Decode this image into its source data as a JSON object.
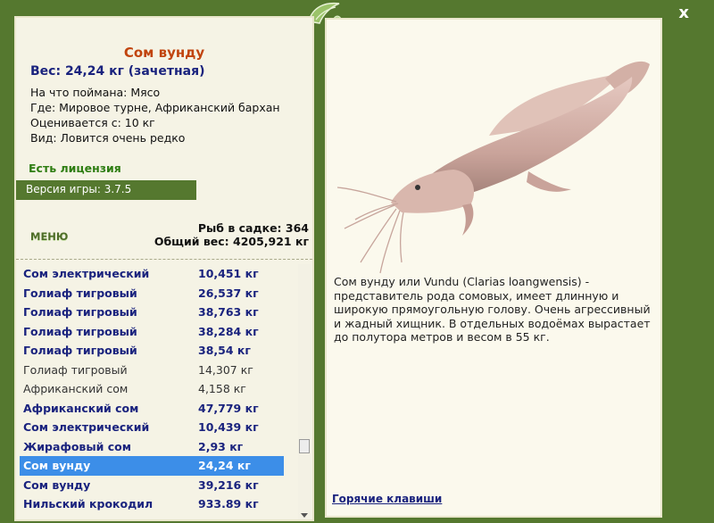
{
  "window": {
    "close_label": "x"
  },
  "fish": {
    "title": "Сом вунду",
    "weight_line": "Вес: 24,24 кг (зачетная)",
    "info": [
      "На что поймана: Мясо",
      "Где: Мировое турне, Африканский бархан",
      "Оценивается с: 10 кг",
      "Вид: Ловится очень редко"
    ],
    "description": "Сом вунду или Vundu (Clarias loangwensis) - представитель рода сомовых, имеет длинную и широкую прямоугольную голову. Очень агрессивный и жадный хищник. В отдельных водоёмах вырастает до полутора метров и весом в 55 кг."
  },
  "license": "Есть лицензия",
  "version": "Версия игры: 3.7.5",
  "menu_label": "МЕНЮ",
  "stats": {
    "cage_count": "Рыб в садке: 364",
    "total_weight": "Общий вес: 4205,921 кг"
  },
  "catch_list": [
    {
      "name": "Сом электрический",
      "weight": "10,451 кг",
      "style": "bold"
    },
    {
      "name": "Голиаф тигровый",
      "weight": "26,537 кг",
      "style": "bold"
    },
    {
      "name": "Голиаф тигровый",
      "weight": "38,763 кг",
      "style": "bold"
    },
    {
      "name": "Голиаф тигровый",
      "weight": "38,284 кг",
      "style": "bold"
    },
    {
      "name": "Голиаф тигровый",
      "weight": "38,54 кг",
      "style": "bold"
    },
    {
      "name": "Голиаф тигровый",
      "weight": "14,307 кг",
      "style": "plain"
    },
    {
      "name": "Африканский сом",
      "weight": "4,158 кг",
      "style": "plain"
    },
    {
      "name": "Африканский сом",
      "weight": "47,779 кг",
      "style": "bold"
    },
    {
      "name": "Сом электрический",
      "weight": "10,439 кг",
      "style": "bold"
    },
    {
      "name": "Жирафовый сом",
      "weight": "2,93 кг",
      "style": "bold"
    },
    {
      "name": "Сом вунду",
      "weight": "24,24 кг",
      "style": "sel"
    },
    {
      "name": "Сом вунду",
      "weight": "39,216 кг",
      "style": "bold"
    },
    {
      "name": "Нильский крокодил",
      "weight": "933.89 кг",
      "style": "bold"
    }
  ],
  "hotkeys_label": "Горячие клавиши",
  "colors": {
    "frame": "#55782f",
    "panel": "#f5f3e5",
    "title": "#c1440e",
    "accent_blue": "#1a237e",
    "selection": "#3c8ee8",
    "license": "#2e7d12"
  },
  "icons": [
    "close-icon",
    "leaf-logo-icon",
    "fish-image",
    "scroll-down-icon"
  ]
}
